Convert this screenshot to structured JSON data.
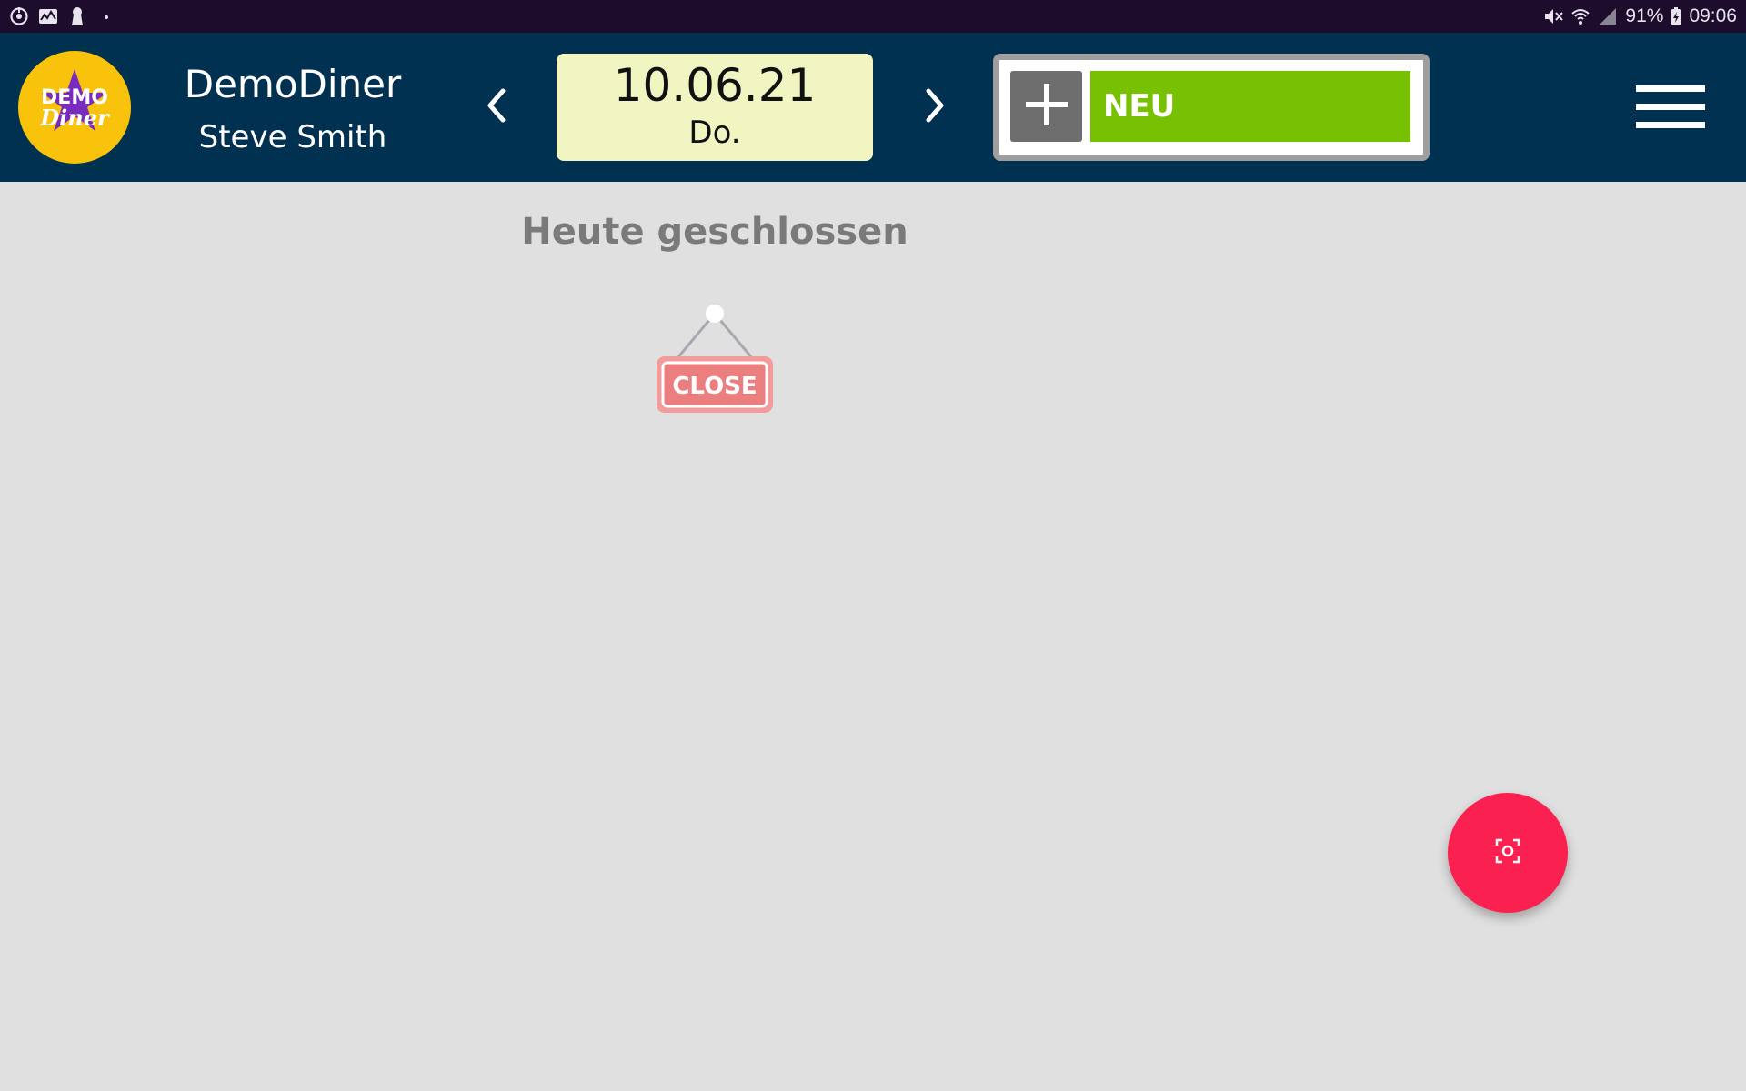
{
  "status_bar": {
    "left_icons": [
      "sync-icon",
      "activity-icon",
      "keyhole-icon",
      "dot-icon"
    ],
    "right_icons": [
      "mute-icon",
      "wifi-icon",
      "signal-icon",
      "battery-icon"
    ],
    "battery": "91%",
    "time": "09:06"
  },
  "header": {
    "logo_text_top": "DEMO",
    "logo_text_bottom": "Diner",
    "app_name": "DemoDiner",
    "user_name": "Steve Smith",
    "date": "10.06.21",
    "weekday": "Do.",
    "prev_icon": "chevron-left-icon",
    "next_icon": "chevron-right-icon",
    "new_button_label": "NEU",
    "add_icon": "plus-icon",
    "menu_icon": "hamburger-menu-icon"
  },
  "main": {
    "closed_message": "Heute geschlossen",
    "sign_text": "CLOSE"
  },
  "fab": {
    "icon": "scan-icon"
  },
  "colors": {
    "status_bar_bg": "#1e0c2c",
    "header_bg": "#003151",
    "date_bg": "#f1f5c1",
    "new_button_green": "#78c002",
    "plus_button_gray": "#6e6e6e",
    "content_bg": "#e0e0e0",
    "fab_red": "#fa2050",
    "logo_yellow": "#f8c30a"
  }
}
